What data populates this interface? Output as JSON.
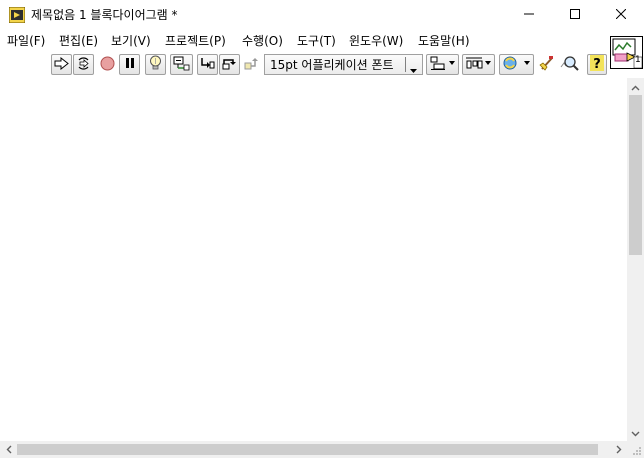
{
  "window": {
    "title": "제목없음 1 블록다이어그램 *"
  },
  "menu": {
    "items": [
      {
        "label": "파일(F)"
      },
      {
        "label": "편집(E)"
      },
      {
        "label": "보기(V)"
      },
      {
        "label": "프로젝트(P)"
      },
      {
        "label": "수행(O)"
      },
      {
        "label": "도구(T)"
      },
      {
        "label": "윈도우(W)"
      },
      {
        "label": "도움말(H)"
      }
    ]
  },
  "toolbar": {
    "font_dropdown": "15pt 어플리케이션 폰트"
  },
  "vi_icon": {
    "number": "1"
  },
  "icons": [
    "labview-app-icon",
    "minimize-icon",
    "maximize-icon",
    "close-icon",
    "run-arrow-icon",
    "run-continuously-icon",
    "abort-icon",
    "pause-icon",
    "highlight-execution-icon",
    "retain-wire-values-icon",
    "step-into-icon",
    "step-over-icon",
    "step-out-icon",
    "align-objects-icon",
    "distribute-objects-icon",
    "reorder-icon",
    "clean-up-diagram-icon",
    "search-icon",
    "context-help-icon",
    "vi-connector-icon"
  ]
}
